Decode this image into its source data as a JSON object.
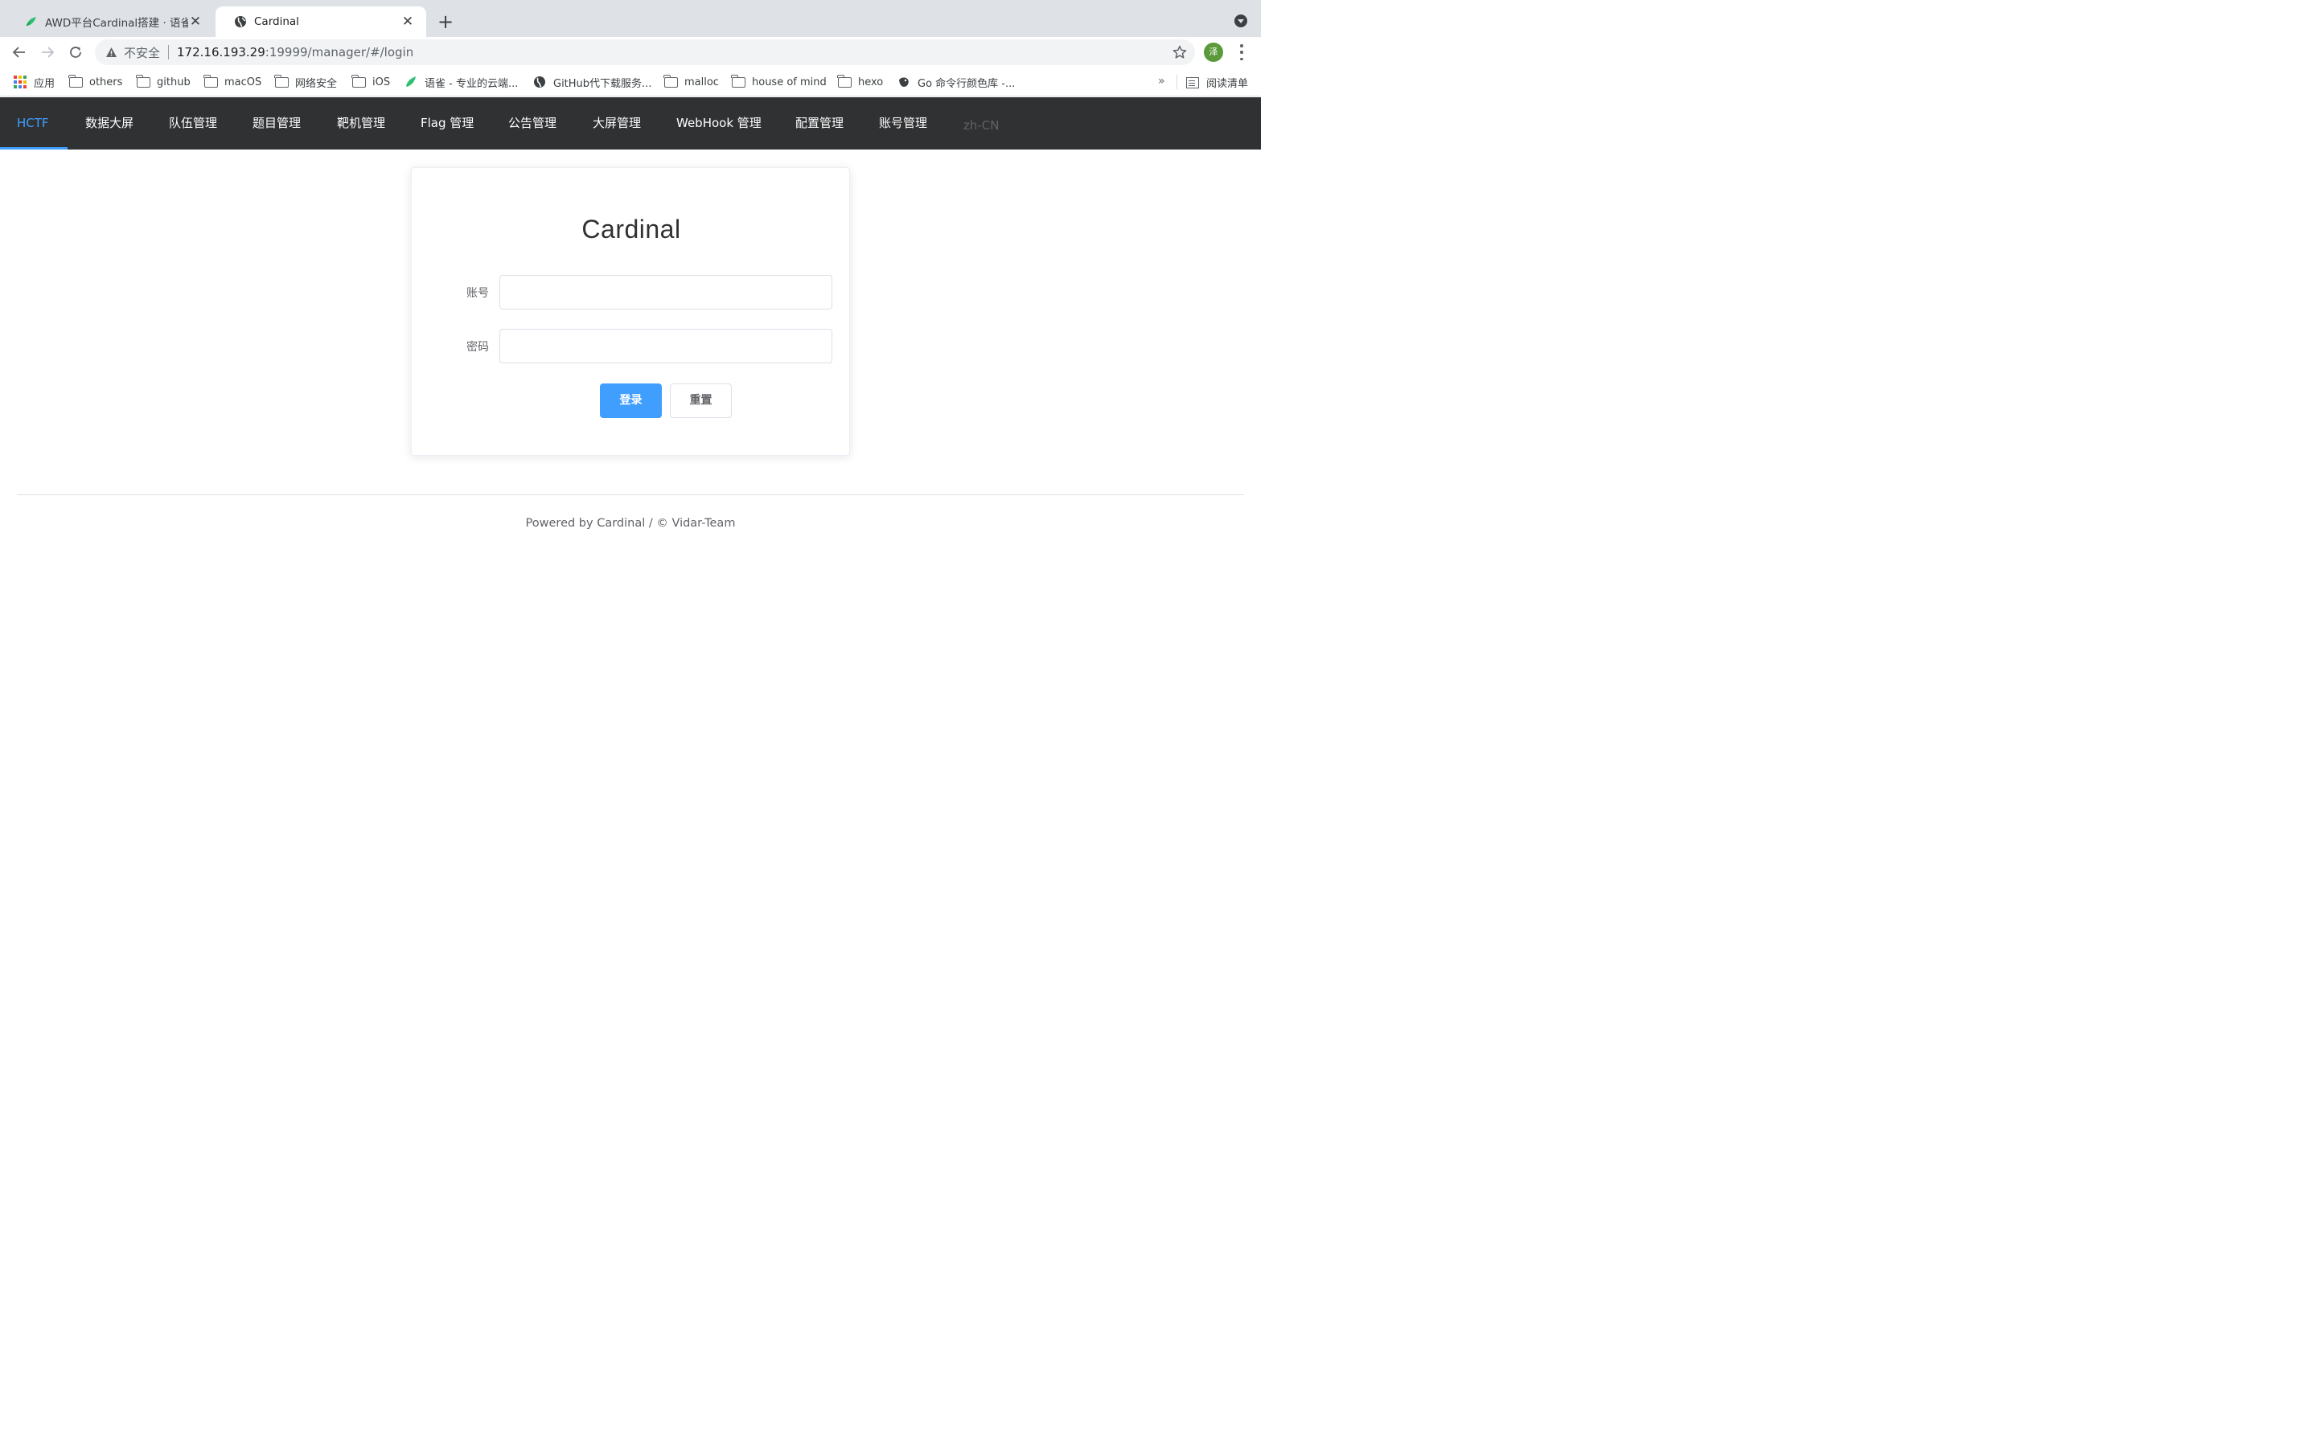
{
  "browser": {
    "tabs": [
      {
        "title": "AWD平台Cardinal搭建 · 语雀",
        "favicon": "yuque-icon",
        "active": false
      },
      {
        "title": "Cardinal",
        "favicon": "globe-icon",
        "active": true
      }
    ],
    "new_tab_label": "+",
    "address": {
      "security_label": "不安全",
      "host": "172.16.193.29",
      "path": ":19999/manager/#/login"
    },
    "profile_initial": "泽",
    "bookmarks": [
      {
        "label": "应用",
        "icon": "apps-grid-icon"
      },
      {
        "label": "others",
        "icon": "folder-icon"
      },
      {
        "label": "github",
        "icon": "folder-icon"
      },
      {
        "label": "macOS",
        "icon": "folder-icon"
      },
      {
        "label": "网络安全",
        "icon": "folder-icon"
      },
      {
        "label": "iOS",
        "icon": "folder-icon"
      },
      {
        "label": "语雀 - 专业的云端...",
        "icon": "yuque-icon"
      },
      {
        "label": "GitHub代下载服务...",
        "icon": "globe-icon"
      },
      {
        "label": "malloc",
        "icon": "folder-icon"
      },
      {
        "label": "house of mind",
        "icon": "folder-icon"
      },
      {
        "label": "hexo",
        "icon": "folder-icon"
      },
      {
        "label": "Go 命令行颜色库 -...",
        "icon": "gopher-icon"
      }
    ],
    "bookmarks_overflow": "»",
    "reading_list": "阅读清单"
  },
  "nav": {
    "brand": "HCTF",
    "items": [
      "数据大屏",
      "队伍管理",
      "题目管理",
      "靶机管理",
      "Flag 管理",
      "公告管理",
      "大屏管理",
      "WebHook 管理",
      "配置管理",
      "账号管理"
    ],
    "language": "zh-CN"
  },
  "login": {
    "title": "Cardinal",
    "account_label": "账号",
    "account_value": "",
    "password_label": "密码",
    "password_value": "",
    "submit_label": "登录",
    "reset_label": "重置"
  },
  "footer": {
    "text": "Powered by Cardinal / © Vidar-Team"
  },
  "colors": {
    "nav_bg": "#303133",
    "accent": "#409eff",
    "text_muted": "#606266"
  }
}
